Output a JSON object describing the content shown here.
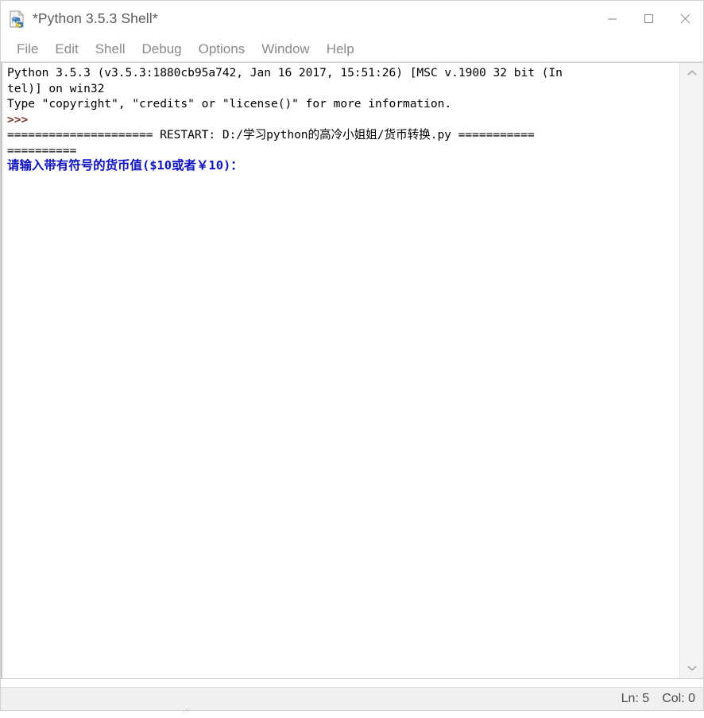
{
  "window": {
    "title": "*Python 3.5.3 Shell*",
    "icon": "python-idle-icon",
    "controls": {
      "minimize": "minimize-button",
      "maximize": "maximize-button",
      "close": "close-button"
    }
  },
  "menubar": {
    "items": [
      {
        "label": "File"
      },
      {
        "label": "Edit"
      },
      {
        "label": "Shell"
      },
      {
        "label": "Debug"
      },
      {
        "label": "Options"
      },
      {
        "label": "Window"
      },
      {
        "label": "Help"
      }
    ]
  },
  "shell": {
    "lines": [
      {
        "text": "Python 3.5.3 (v3.5.3:1880cb95a742, Jan 16 2017, 15:51:26) [MSC v.1900 32 bit (In",
        "style": "black"
      },
      {
        "text": "tel)] on win32",
        "style": "black"
      },
      {
        "text": "Type \"copyright\", \"credits\" or \"license()\" for more information.",
        "style": "black"
      },
      {
        "text": ">>> ",
        "style": "prompt"
      },
      {
        "text": "===================== RESTART: D:/学习python的高冷小姐姐/货币转换.py ===========",
        "style": "black"
      },
      {
        "text": "==========",
        "style": "black"
      },
      {
        "text": "请输入带有符号的货币值($10或者￥10)：",
        "style": "blue"
      }
    ]
  },
  "scrollbar": {
    "up_arrow": "scroll-up-arrow",
    "down_arrow": "scroll-down-arrow"
  },
  "statusbar": {
    "line_label": "Ln: 5",
    "col_label": "Col: 0"
  },
  "colors": {
    "prompt": "#7a3a32",
    "output_blue": "#0f12bf",
    "text": "#000000",
    "menu_text": "#8a8a8a",
    "title_text": "#5a5a5a",
    "statusbar_bg": "#f0f0f0"
  }
}
